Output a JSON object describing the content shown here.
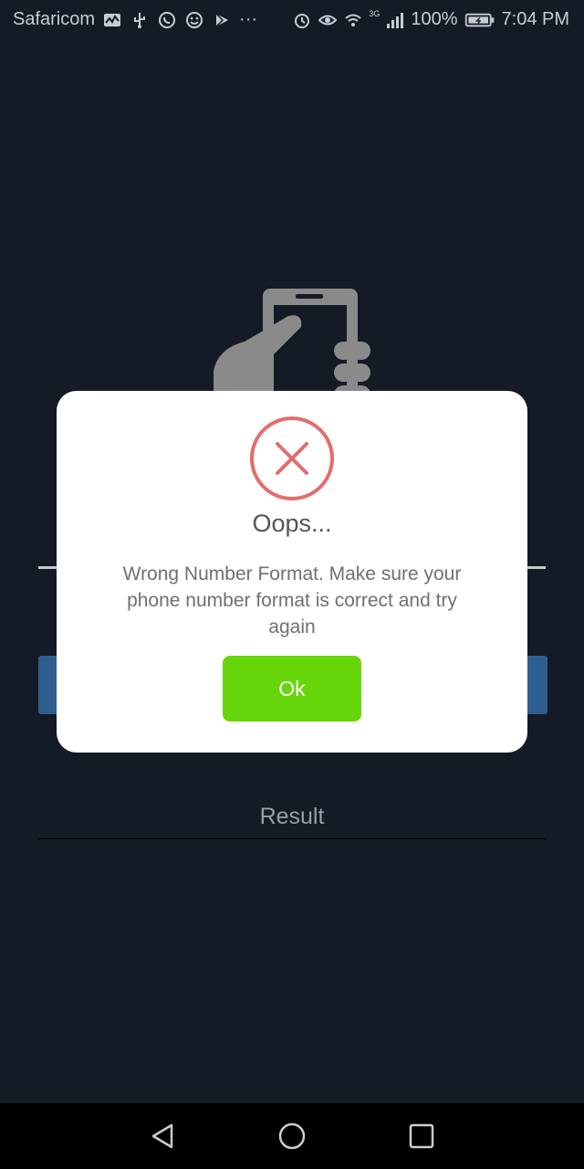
{
  "status_bar": {
    "carrier": "Safaricom",
    "network_label": "3G",
    "battery": "100%",
    "time": "7:04 PM",
    "more": "···"
  },
  "main": {
    "result_label": "Result"
  },
  "dialog": {
    "title": "Oops...",
    "message": "Wrong Number Format. Make sure your phone number format is correct and try again",
    "ok_label": "Ok"
  },
  "colors": {
    "background": "#141a26",
    "error_red": "#e26d6d",
    "ok_green": "#66d60a",
    "illustration_gray": "#8a8a8a"
  },
  "icons": [
    "activity-icon",
    "usb-icon",
    "whatsapp-icon",
    "smiley-icon",
    "play-store-icon",
    "alarm-icon",
    "eye-icon",
    "wifi-icon",
    "signal-icon",
    "battery-icon",
    "back-icon",
    "home-icon",
    "recents-icon",
    "error-x-icon",
    "hand-phone-illustration"
  ]
}
